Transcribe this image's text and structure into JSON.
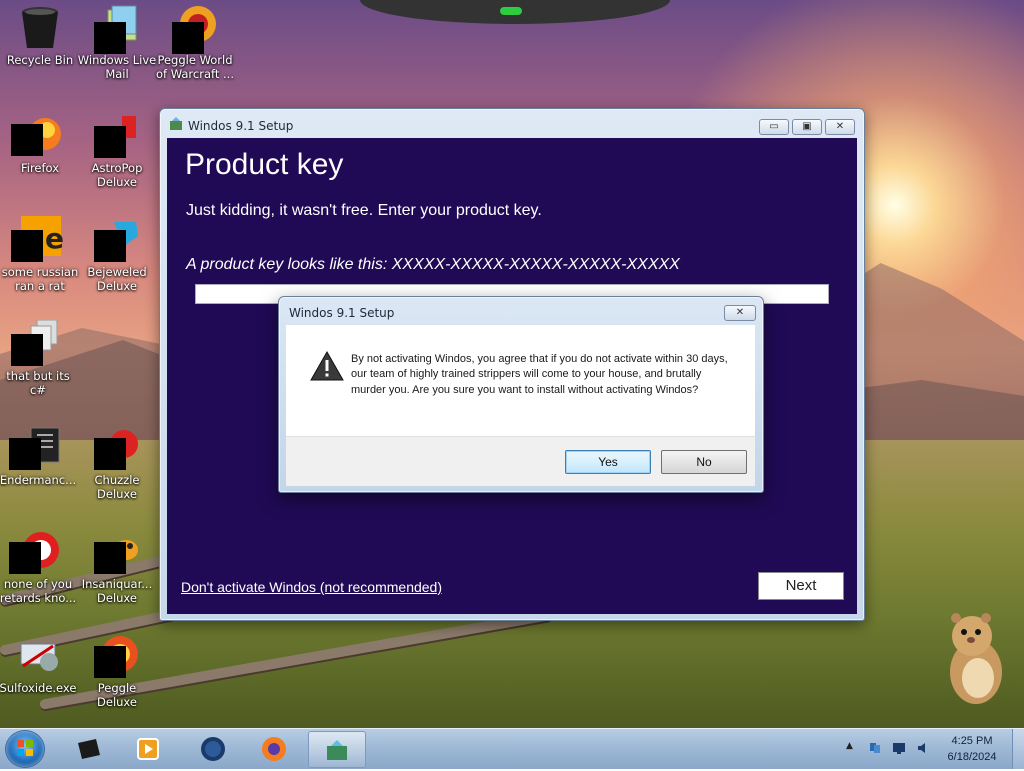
{
  "desktop": {
    "icons": [
      {
        "label": "Recycle Bin"
      },
      {
        "label": "Windows Live Mail"
      },
      {
        "label": "Peggle World of Warcraft ..."
      },
      {
        "label": "Firefox"
      },
      {
        "label": "AstroPop Deluxe"
      },
      {
        "label": "some russian ran a rat"
      },
      {
        "label": "Bejeweled Deluxe"
      },
      {
        "label": "that but its c#"
      },
      {
        "label": "Endermanc..."
      },
      {
        "label": "Chuzzle Deluxe"
      },
      {
        "label": "none of you retards kno..."
      },
      {
        "label": "Insaniquar... Deluxe"
      },
      {
        "label": "Sulfoxide.exe"
      },
      {
        "label": "Peggle Deluxe"
      }
    ]
  },
  "setup_window": {
    "title": "Windos 9.1 Setup",
    "heading": "Product key",
    "subtext": "Just kidding, it wasn't free. Enter your product key.",
    "hint": "A product key looks like this: XXXXX-XXXXX-XXXXX-XXXXX-XXXXX",
    "product_key_value": "",
    "skip_link": "Don't activate Windos (not recommended)",
    "next_label": "Next",
    "min_glyph": "▭",
    "max_glyph": "▣",
    "close_glyph": "✕"
  },
  "dialog": {
    "title": "Windos 9.1 Setup",
    "close_glyph": "✕",
    "message": "By not activating Windos, you agree that if you do not activate within 30 days, our team of highly trained strippers will come to your house, and brutally murder you. Are you sure you want to install without activating Windos?",
    "yes_label": "Yes",
    "no_label": "No",
    "icon": "warning-icon"
  },
  "taskbar": {
    "items": [
      "generic-box-icon",
      "media-player-icon",
      "globe-icon",
      "firefox-icon",
      "setup-icon"
    ],
    "clock_time": "4:25 PM",
    "clock_date": "6/18/2024",
    "tray_up_arrow": "▲"
  },
  "colors": {
    "setup_bg": "#200a55",
    "taskbar": "#9fb9d6",
    "default_button_border": "#3c7fb1"
  }
}
